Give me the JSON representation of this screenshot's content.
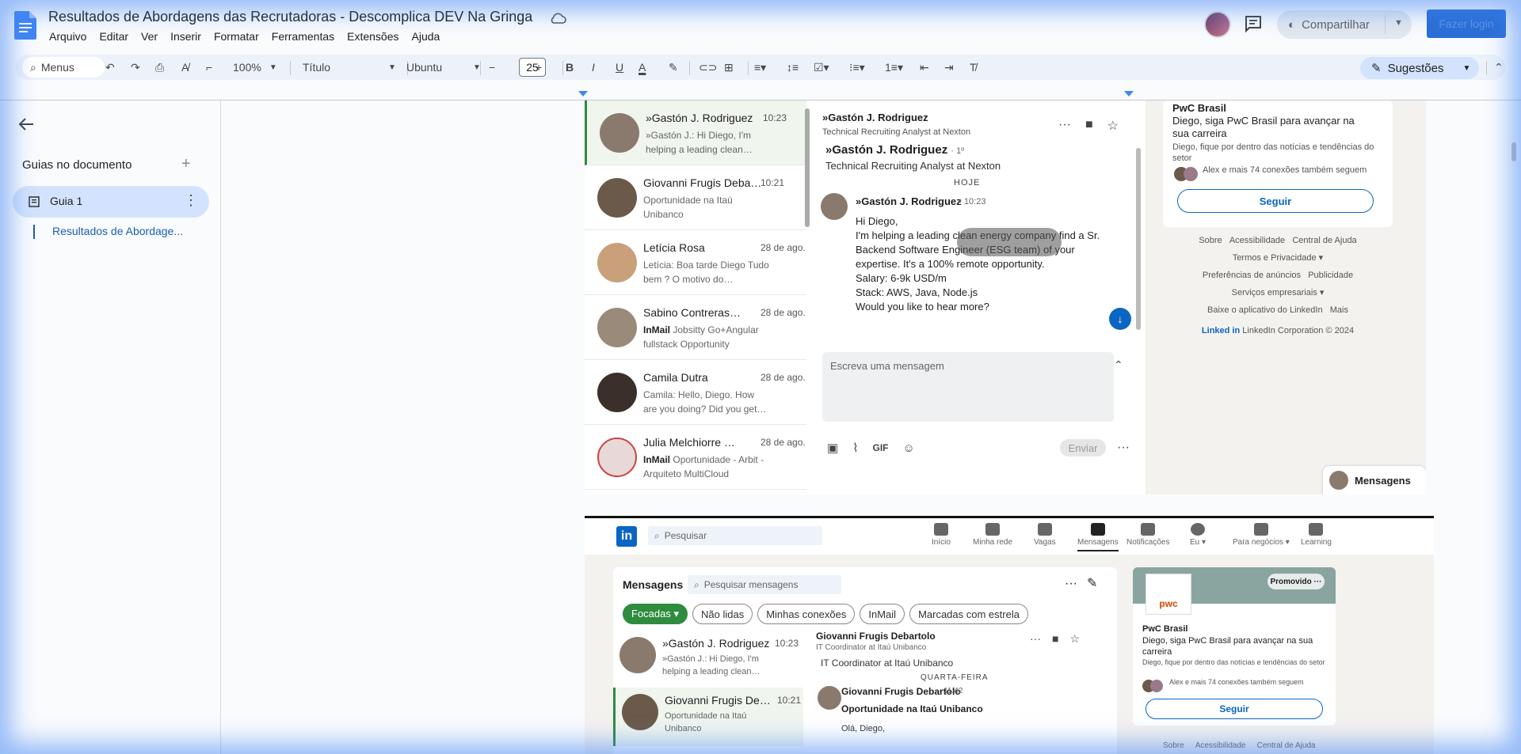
{
  "app": {
    "doc_title": "Resultados de Abordagens das Recrutadoras - Descomplica DEV Na Gringa",
    "menus": [
      "Arquivo",
      "Editar",
      "Ver",
      "Inserir",
      "Formatar",
      "Ferramentas",
      "Extensões",
      "Ajuda"
    ],
    "share_label": "Compartilhar",
    "login_label": "Fazer login"
  },
  "toolbar": {
    "search_label": "Menus",
    "zoom": "100%",
    "style": "Título",
    "font": "Ubuntu",
    "font_size": "25",
    "suggestions_label": "Sugestões"
  },
  "outline": {
    "header": "Guias no documento",
    "guide_label": "Guia 1",
    "heading_link": "Resultados de Abordage..."
  },
  "linkedin1": {
    "conversations": [
      {
        "name": "»Gastón J. Rodriguez",
        "time": "10:23",
        "preview": "»Gastón J.: Hi Diego, I'm helping a leading clean…",
        "active": true
      },
      {
        "name": "Giovanni Frugis Debartolo",
        "time": "10:21",
        "preview": "Oportunidade na Itaú Unibanco"
      },
      {
        "name": "Letícia Rosa",
        "time": "28 de ago.",
        "preview": "Letícia: Boa tarde Diego Tudo bem ? O motivo do…"
      },
      {
        "name": "Sabino Contreras…",
        "time": "28 de ago.",
        "tag": "InMail",
        "preview": "Jobsitty Go+Angular fullstack Opportunity"
      },
      {
        "name": "Camila Dutra",
        "time": "28 de ago.",
        "preview": "Camila: Hello, Diego. How are you doing? Did you get…"
      },
      {
        "name": "Julia Melchiorre …",
        "time": "28 de ago.",
        "tag": "InMail",
        "preview": "Oportunidade - Arbit - Arquiteto MultiCloud"
      }
    ],
    "thread": {
      "header_name": "»Gastón J. Rodriguez",
      "header_sub": "Technical Recruiting Analyst at Nexton",
      "name": "»Gastón J. Rodriguez",
      "degree": "· 1º",
      "title": "Technical Recruiting Analyst at Nexton",
      "day": "HOJE",
      "sender": "»Gastón J. Rodriguez",
      "send_time": "• 10:23",
      "body": [
        "Hi Diego,",
        "I'm helping a leading clean energy company find a Sr.",
        "Backend Software Engineer (ESG team) of your",
        "expertise. It's a 100% remote opportunity.",
        "Salary: 6-9k USD/m",
        "Stack: AWS, Java, Node.js",
        "Would you like to hear more?"
      ],
      "compose_placeholder": "Escreva uma mensagem",
      "gif_label": "GIF",
      "send_label": "Enviar"
    },
    "sidebar": {
      "brand": "PwC Brasil",
      "line": "Diego, siga PwC Brasil para avançar na sua carreira",
      "small": "Diego, fique por dentro das notícias e tendências do setor",
      "connections": "Alex e mais 74 conexões também seguem",
      "follow_label": "Seguir"
    },
    "footer": [
      [
        "Sobre",
        "Acessibilidade",
        "Central de Ajuda"
      ],
      [
        "Termos e Privacidade ▾"
      ],
      [
        "Preferências de anúncios",
        "Publicidade"
      ],
      [
        "Serviços empresariais ▾"
      ],
      [
        "Baixe o aplicativo do LinkedIn",
        "Mais"
      ]
    ],
    "copyright_brand": "Linked in",
    "copyright": "LinkedIn Corporation © 2024",
    "messages_tab": "Mensagens"
  },
  "linkedin2": {
    "search_placeholder": "Pesquisar",
    "nav": [
      "Início",
      "Minha rede",
      "Vagas",
      "Mensagens",
      "Notificações",
      "Eu ▾",
      "Para negócios ▾",
      "Learning"
    ],
    "messages_title": "Mensagens",
    "messages_search": "Pesquisar mensagens",
    "filters": [
      "Focadas ▾",
      "Não lidas",
      "Minhas conexões",
      "InMail",
      "Marcadas com estrela"
    ],
    "conversations": [
      {
        "name": "»Gastón J. Rodriguez",
        "time": "10:23",
        "preview": "»Gastón J.: Hi Diego, I'm helping a leading clean…"
      },
      {
        "name": "Giovanni Frugis Debartolo",
        "time": "10:21",
        "preview": "Oportunidade na Itaú Unibanco",
        "active": true
      }
    ],
    "thread": {
      "name": "Giovanni Frugis Debartolo",
      "sub": "IT Coordinator at Itaú Unibanco",
      "title": "IT Coordinator at Itaú Unibanco",
      "day": "QUARTA-FEIRA",
      "sender": "Giovanni Frugis Debartolo",
      "time": "· 11:42",
      "subject": "Oportunidade na Itaú Unibanco",
      "hello": "Olá, Diego,"
    },
    "sidebar": {
      "logo": "pwc",
      "promoted": "Promovido ···",
      "brand": "PwC Brasil",
      "line": "Diego, siga PwC Brasil para avançar na sua carreira",
      "small": "Diego, fique por dentro das notícias e tendências do setor",
      "connections": "Alex e mais 74 conexões também seguem",
      "follow_label": "Seguir"
    },
    "footer": [
      "Sobre",
      "Acessibilidade",
      "Central de Ajuda"
    ]
  }
}
